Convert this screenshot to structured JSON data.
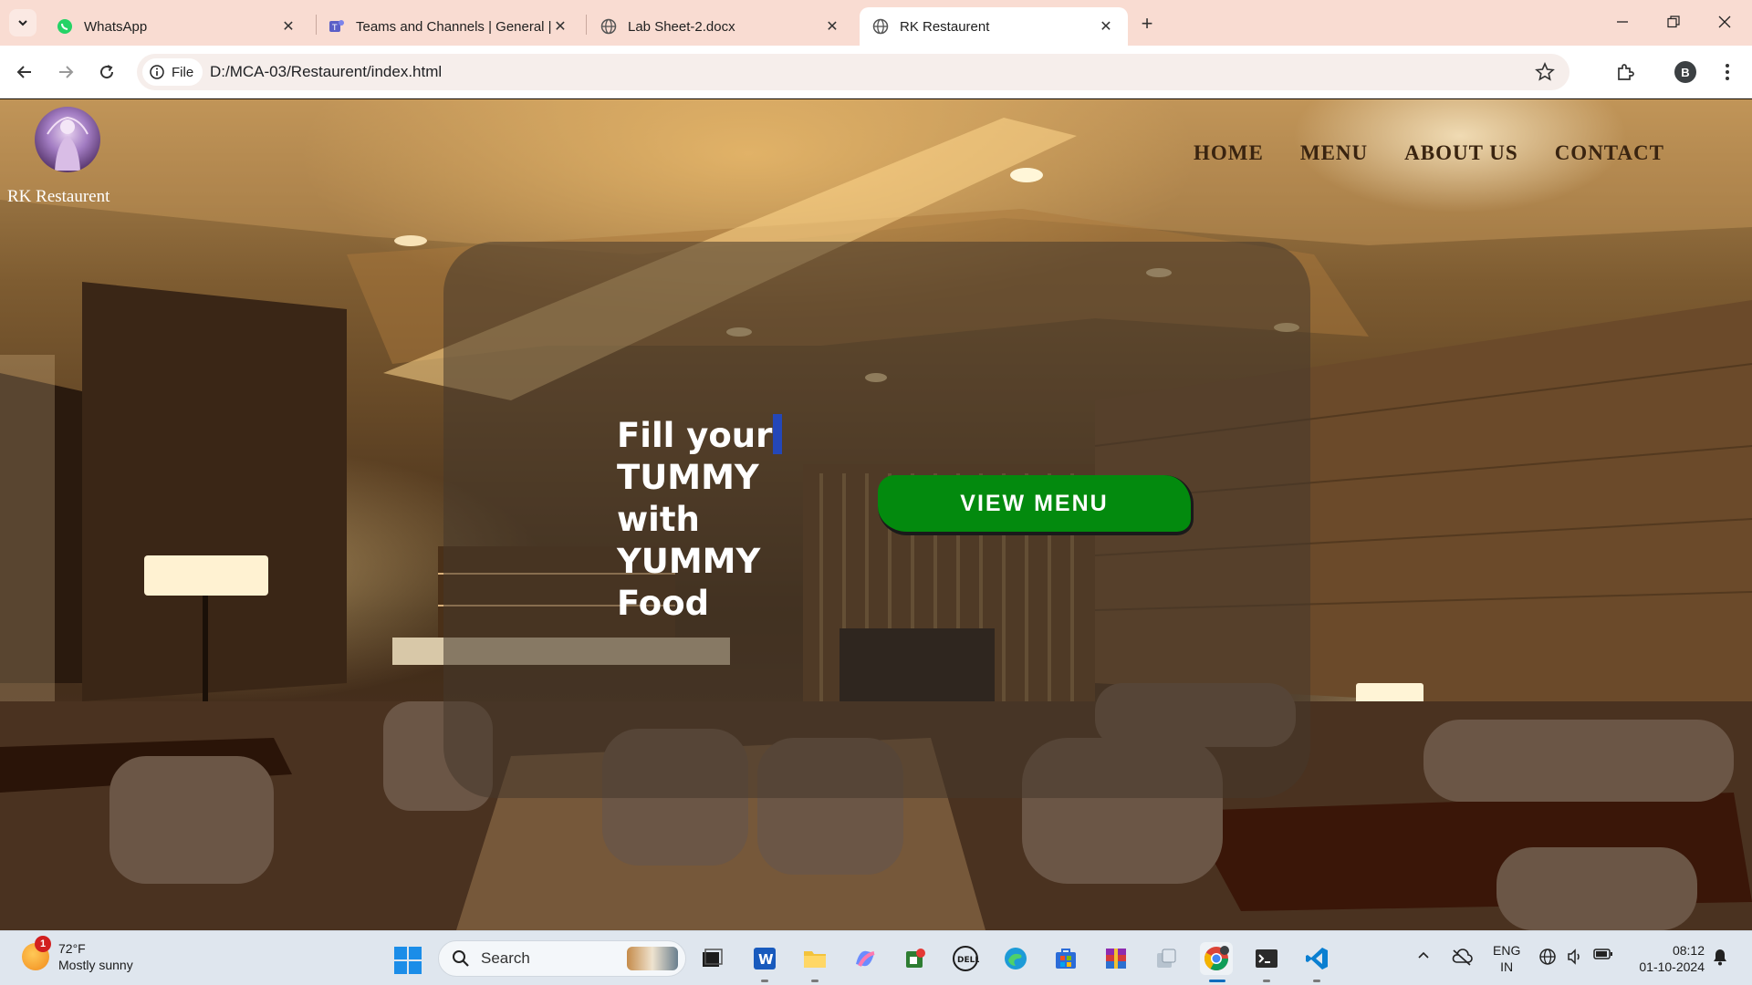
{
  "browser": {
    "tabs": [
      {
        "title": "WhatsApp",
        "active": false
      },
      {
        "title": "Teams and Channels | General |",
        "active": false
      },
      {
        "title": "Lab Sheet-2.docx",
        "active": false
      },
      {
        "title": "RK Restaurent",
        "active": true
      }
    ],
    "address": {
      "chip_label": "File",
      "url": "D:/MCA-03/Restaurent/index.html"
    },
    "profile_initial": "B"
  },
  "site": {
    "brand": "RK Restaurent",
    "nav": [
      "HOME",
      "MENU",
      "ABOUT US",
      "CONTACT"
    ],
    "hero_lines": [
      "Fill your",
      "TUMMY",
      "with",
      "YUMMY",
      "Food"
    ],
    "cta_label": "VIEW MENU",
    "colors": {
      "cta": "#038a0e",
      "caret": "#2447b8",
      "card": "rgba(70,56,44,0.55)"
    }
  },
  "taskbar": {
    "weather": {
      "badge": "1",
      "temp": "72°F",
      "desc": "Mostly sunny"
    },
    "search_label": "Search",
    "apps": [
      "task-view",
      "word",
      "file-explorer",
      "copilot",
      "app-paint",
      "dell",
      "edge",
      "store",
      "winrar",
      "app-misc",
      "chrome",
      "terminal",
      "vscode"
    ],
    "tray": {
      "lang1": "ENG",
      "lang2": "IN",
      "time": "08:12",
      "date": "01-10-2024"
    }
  }
}
